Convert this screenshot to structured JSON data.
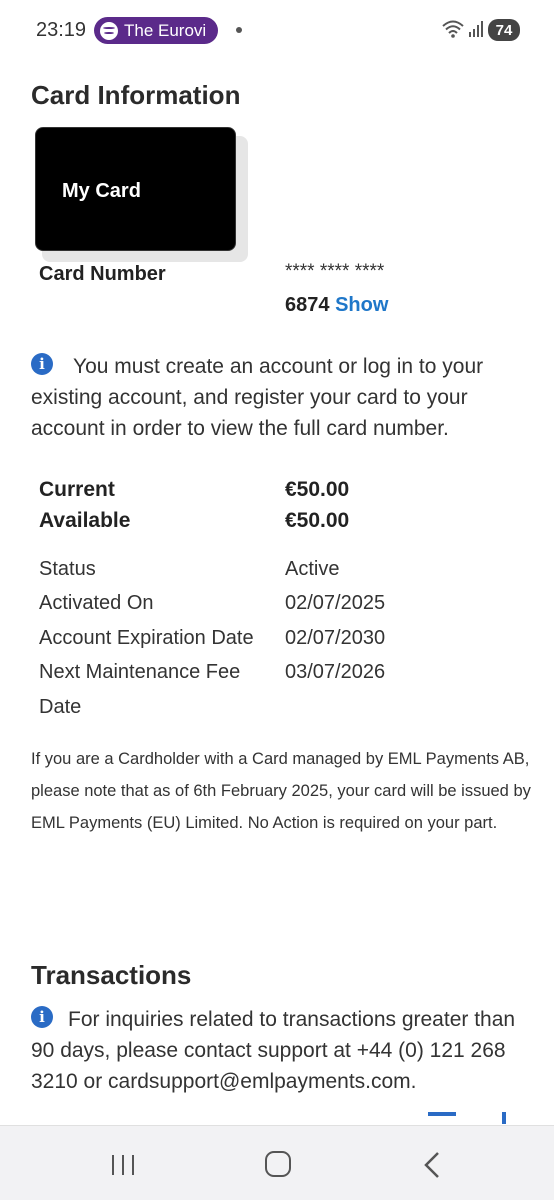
{
  "status_bar": {
    "time": "23:19",
    "media_label": "The Eurovi",
    "battery": "74"
  },
  "card_info": {
    "title": "Card Information",
    "card_image_label": "My Card",
    "card_number_label": "Card Number",
    "card_number_masked": "**** **** ****",
    "card_number_last4": "6874",
    "show_link": "Show",
    "account_notice": "You must create an account or log in to your existing account, and register your card to your account in order to view the full card number."
  },
  "balances": {
    "current_label": "Current",
    "current_value": "€50.00",
    "available_label": "Available",
    "available_value": "€50.00"
  },
  "details": [
    {
      "label": "Status",
      "value": "Active"
    },
    {
      "label": "Activated On",
      "value": "02/07/2025"
    },
    {
      "label": "Account Expiration Date",
      "value": "02/07/2030"
    },
    {
      "label": "Next Maintenance Fee",
      "value": "03/07/2026"
    },
    {
      "label": "Date",
      "value": ""
    }
  ],
  "eml_notice": "If you are a Cardholder with a Card managed by EML Payments AB, please note that as of 6th February 2025, your card will be issued by EML Payments (EU) Limited. No Action is required on your part.",
  "transactions": {
    "title": "Transactions",
    "notice": "For inquiries related to transactions greater than 90 days, please contact support at +44 (0) 121 268 3210 or cardsupport@emlpayments.com."
  },
  "colors": {
    "link": "#1f77c9",
    "info_icon": "#2a6bc5",
    "media_pill": "#5b2a8a"
  }
}
